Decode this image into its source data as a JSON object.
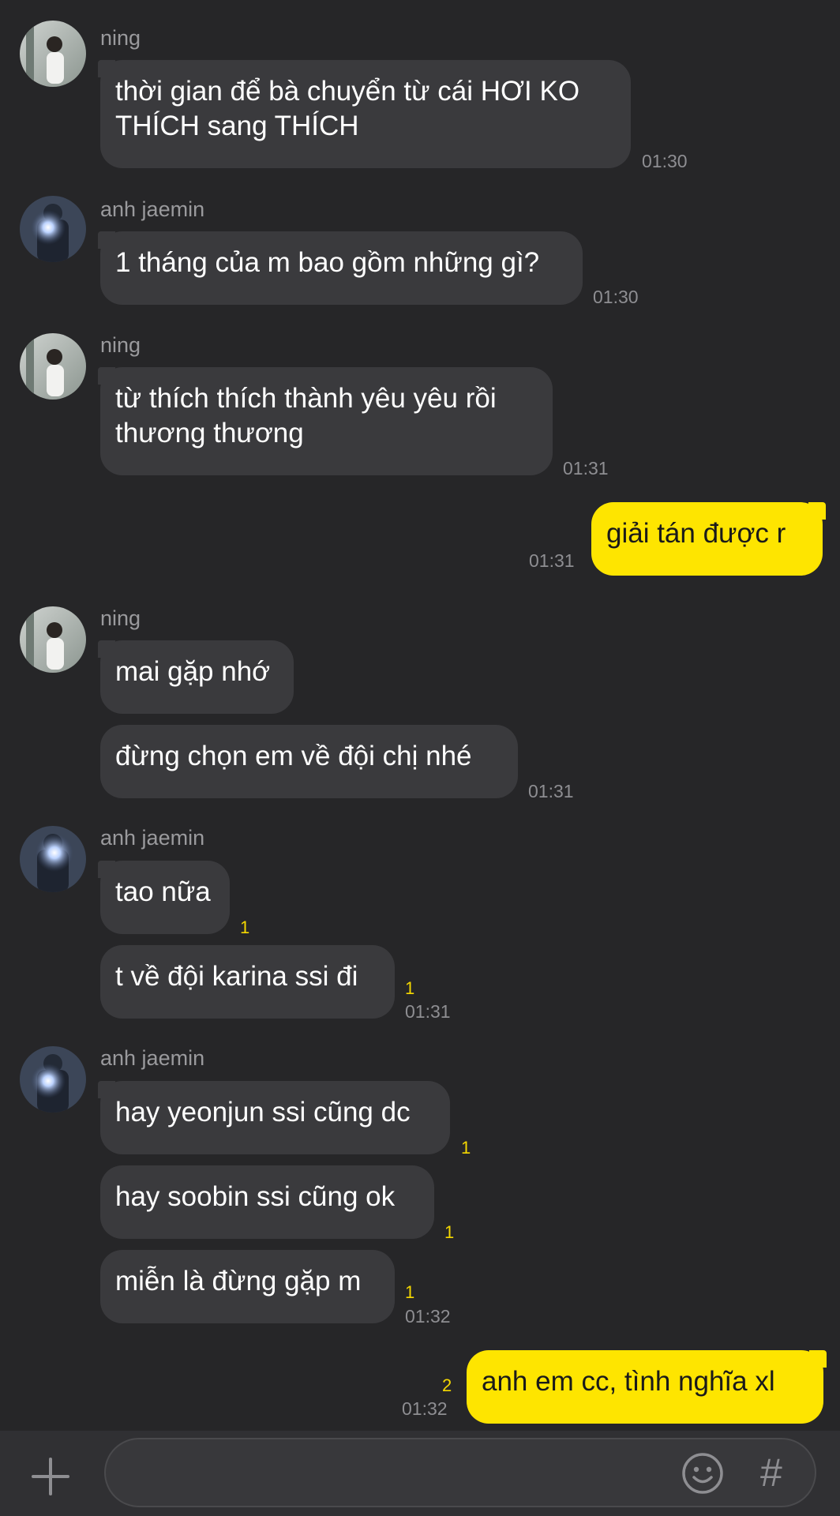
{
  "chat": {
    "messages": [
      {
        "sender": "ning",
        "text": "thời gian để bà chuyển từ cái HƠI KO\nTHÍCH sang THÍCH",
        "time": "01:30"
      },
      {
        "sender": "anh jaemin",
        "text": "1 tháng của m bao gồm những gì?",
        "time": "01:30"
      },
      {
        "sender": "ning",
        "text": "từ thích thích thành yêu yêu rồi\nthương thương",
        "time": "01:31"
      },
      {
        "sender": "me",
        "text": "giải tán được r",
        "time": "01:31"
      },
      {
        "sender": "ning",
        "text": "mai gặp nhớ"
      },
      {
        "sender": "ning",
        "text": "đừng chọn em về đội chị nhé",
        "time": "01:31"
      },
      {
        "sender": "anh jaemin",
        "text": "tao nữa",
        "unread": "1"
      },
      {
        "sender": "anh jaemin",
        "text": "t về đội karina ssi đi",
        "unread": "1",
        "time": "01:31"
      },
      {
        "sender": "anh jaemin",
        "text": "hay yeonjun ssi cũng dc",
        "unread": "1"
      },
      {
        "sender": "anh jaemin",
        "text": "hay soobin ssi cũng ok",
        "unread": "1"
      },
      {
        "sender": "anh jaemin",
        "text": "miễn là đừng gặp m",
        "unread": "1",
        "time": "01:32"
      },
      {
        "sender": "me",
        "text": "anh em cc, tình nghĩa xl",
        "unread": "2",
        "time": "01:32"
      }
    ]
  },
  "input_bar": {
    "plus_icon": "plus-icon",
    "emoji_icon": "emoji-icon",
    "hash_label": "#"
  },
  "colors": {
    "background": "#262628",
    "bubble_other": "#3a3a3d",
    "bubble_me": "#fee500",
    "unread": "#f5d800"
  }
}
